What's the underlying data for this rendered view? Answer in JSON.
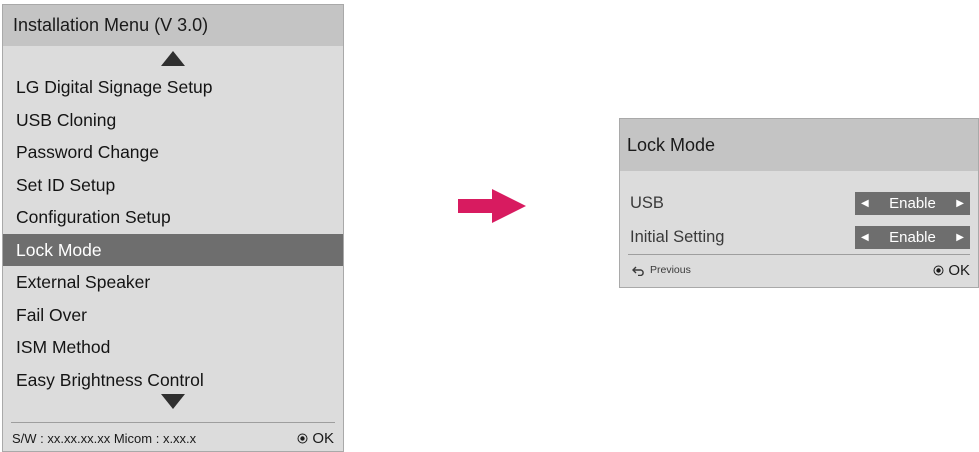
{
  "install_menu": {
    "title": "Installation Menu (V 3.0)",
    "items": [
      {
        "label": "LG Digital Signage Setup"
      },
      {
        "label": "USB Cloning"
      },
      {
        "label": "Password Change"
      },
      {
        "label": "Set ID Setup"
      },
      {
        "label": "Configuration Setup"
      },
      {
        "label": "Lock Mode",
        "selected": true
      },
      {
        "label": "External Speaker"
      },
      {
        "label": "Fail Over"
      },
      {
        "label": "ISM Method"
      },
      {
        "label": "Easy Brightness Control"
      }
    ],
    "footer_info": "S/W : xx.xx.xx.xx Micom : x.xx.x",
    "ok_label": "OK"
  },
  "lock_mode": {
    "title": "Lock Mode",
    "rows": [
      {
        "label": "USB",
        "value": "Enable"
      },
      {
        "label": "Initial Setting",
        "value": "Enable"
      }
    ],
    "previous_label": "Previous",
    "ok_label": "OK"
  },
  "colors": {
    "panel_bg": "#dcdcdc",
    "header_bg": "#c4c4c4",
    "selected_bg": "#6e6e6e",
    "arrow": "#d81b60"
  }
}
